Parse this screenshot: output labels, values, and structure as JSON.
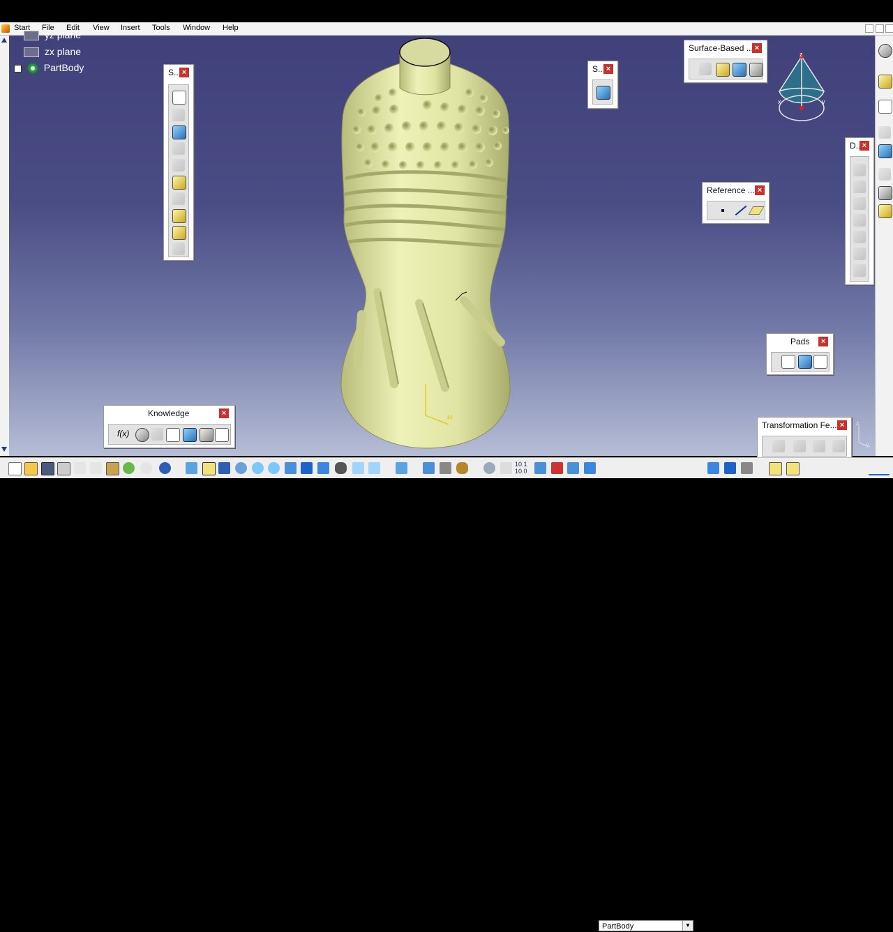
{
  "menubar": {
    "items": [
      {
        "key": "start",
        "label": "Start"
      },
      {
        "key": "file",
        "label": "File"
      },
      {
        "key": "edit",
        "label": "Edit"
      },
      {
        "key": "view",
        "label": "View"
      },
      {
        "key": "insert",
        "label": "Insert"
      },
      {
        "key": "tools",
        "label": "Tools"
      },
      {
        "key": "window",
        "label": "Window"
      },
      {
        "key": "help",
        "label": "Help"
      }
    ]
  },
  "tree": {
    "items": [
      "yz plane",
      "zx plane",
      "PartBody"
    ]
  },
  "toolbars": {
    "sketch_based": {
      "title": "S.."
    },
    "surface_small": {
      "title": "S.."
    },
    "surface_based": {
      "title": "Surface-Based ..."
    },
    "dressup": {
      "title": "D.."
    },
    "reference": {
      "title": "Reference ..."
    },
    "pads": {
      "title": "Pads"
    },
    "knowledge": {
      "title": "Knowledge"
    },
    "transformation": {
      "title": "Transformation Fe..."
    }
  },
  "close_symbol": "×",
  "compass": {
    "z": "z",
    "x": "x",
    "y": "y"
  },
  "axes": {
    "h": "H",
    "v": "V",
    "z": "z",
    "y": "y"
  },
  "knowledge_fx": "f(x)",
  "bottom_toolbar": {
    "current_body": "PartBody",
    "ratio_label": "10.1\n10.0"
  },
  "colors": {
    "viewport_top": "#40417a",
    "viewport_bottom": "#b6bdd6",
    "part": "#e4e8a8",
    "close_button": "#c8322d"
  }
}
